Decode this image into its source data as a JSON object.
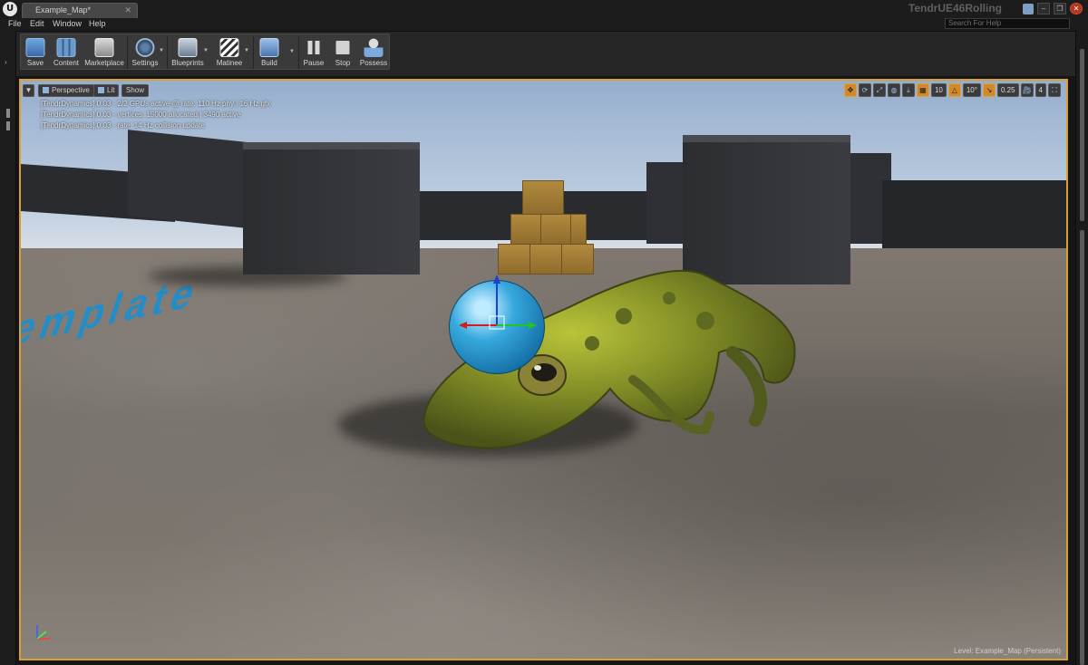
{
  "app": {
    "logo_text": "U",
    "document_tab": "Example_Map*",
    "project_name": "TendrUE46Rolling"
  },
  "menu": {
    "items": [
      "File",
      "Edit",
      "Window",
      "Help"
    ],
    "search_placeholder": "Search For Help"
  },
  "toolbar": {
    "buttons": [
      {
        "label": "Save",
        "icon": "save-icon"
      },
      {
        "label": "Content",
        "icon": "content-browser-icon"
      },
      {
        "label": "Marketplace",
        "icon": "marketplace-icon"
      },
      {
        "label": "Settings",
        "icon": "settings-icon"
      },
      {
        "label": "Blueprints",
        "icon": "blueprints-icon"
      },
      {
        "label": "Matinee",
        "icon": "matinee-icon"
      },
      {
        "label": "Build",
        "icon": "build-icon"
      },
      {
        "label": "Pause",
        "icon": "pause-icon"
      },
      {
        "label": "Stop",
        "icon": "stop-icon"
      },
      {
        "label": "Possess",
        "icon": "possess-icon"
      }
    ]
  },
  "viewport": {
    "view_mode": "Perspective",
    "lighting": "Lit",
    "show": "Show",
    "stats": [
      "[TendrDynamics] 0.03 - 2/2 GPUs active @ rate: 110 Hz phy | 16 Hz gfx",
      "[TendrDynamics] 0.03 - vertices: 15000 allocated | 3490 active",
      "[TendrDynamics] 0.03 - rate: 14 Hz collision update"
    ],
    "snap": {
      "grid": "10",
      "rotation": "10°",
      "scale": "0.25",
      "camera_speed": "4"
    },
    "level_label": "Level:  Example_Map (Persistent)",
    "floor_text": "emplate"
  },
  "colors": {
    "accent_border": "#d9a030",
    "sphere": "#2b97cf",
    "template_text": "#1a8fd0"
  }
}
